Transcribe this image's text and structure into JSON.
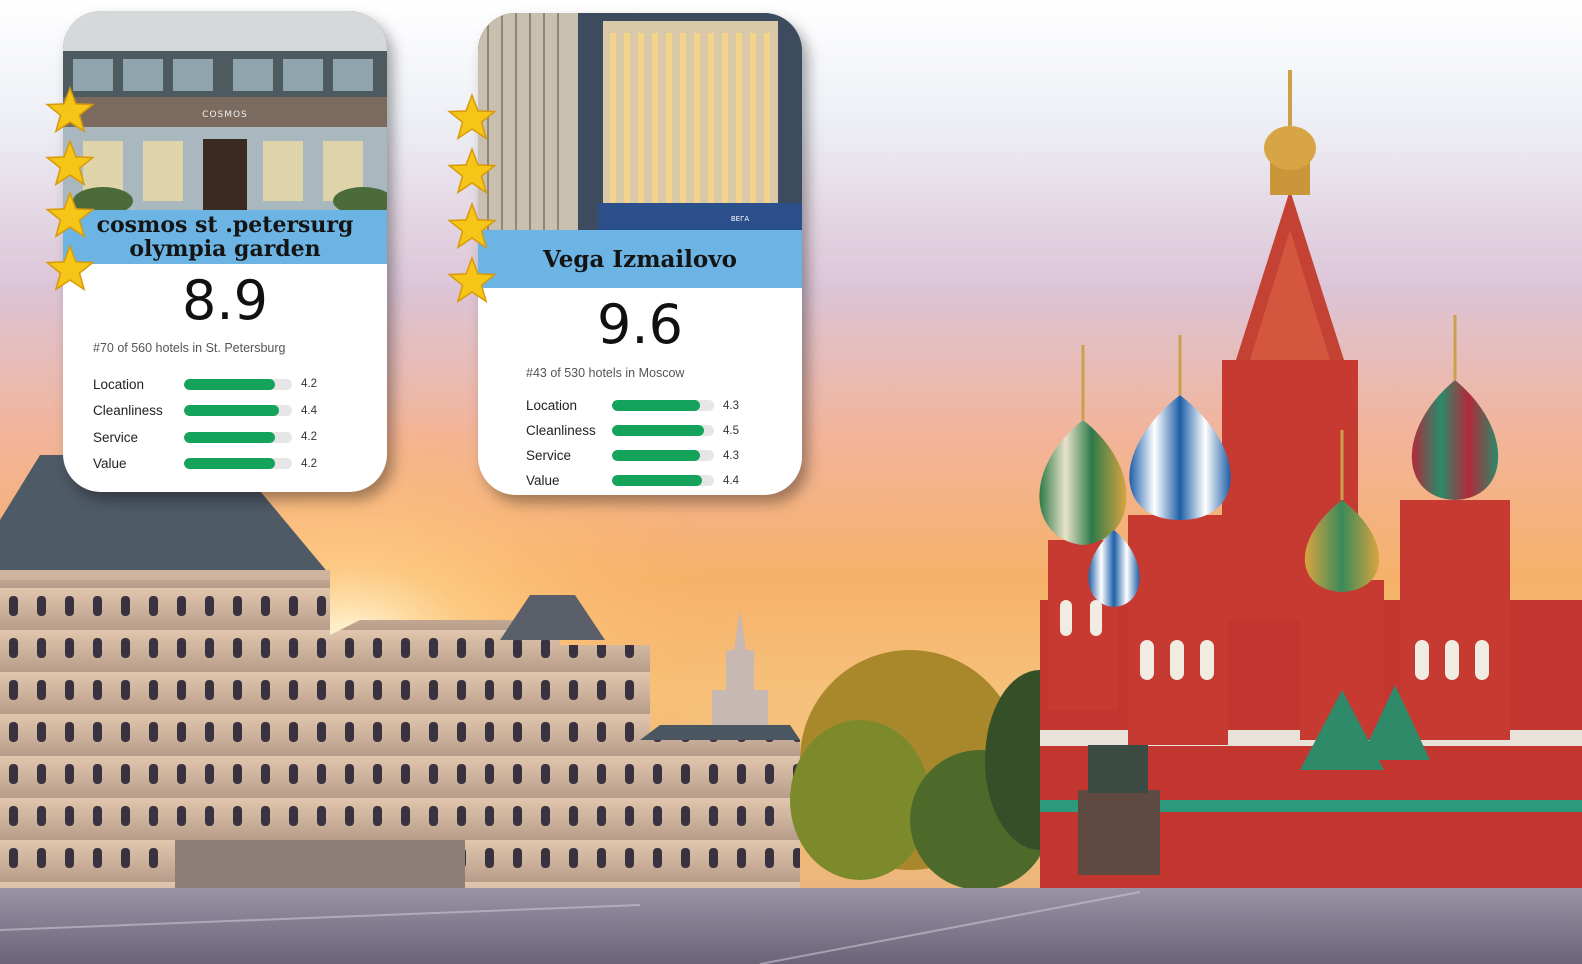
{
  "hotels": [
    {
      "name_line1": "cosmos st .petersurg",
      "name_line2": "olympia garden",
      "score": "8.9",
      "rank": "#70 of 560 hotels in St. Petersburg",
      "star_count": 4,
      "ratings": [
        {
          "label": "Location",
          "value": "4.2",
          "fraction": 0.84
        },
        {
          "label": "Cleanliness",
          "value": "4.4",
          "fraction": 0.88
        },
        {
          "label": "Service",
          "value": "4.2",
          "fraction": 0.84
        },
        {
          "label": "Value",
          "value": "4.2",
          "fraction": 0.84
        }
      ],
      "photo_sign": "COSMOS"
    },
    {
      "name": "Vega Izmailovo",
      "score": "9.6",
      "rank": "#43 of 530 hotels in Moscow",
      "star_count": 4,
      "ratings": [
        {
          "label": "Location",
          "value": "4.3",
          "fraction": 0.86
        },
        {
          "label": "Cleanliness",
          "value": "4.5",
          "fraction": 0.9
        },
        {
          "label": "Service",
          "value": "4.3",
          "fraction": 0.86
        },
        {
          "label": "Value",
          "value": "4.4",
          "fraction": 0.88
        }
      ],
      "photo_sign": "ВЕГА"
    }
  ],
  "colors": {
    "band": "#6cb4e4",
    "bar_fill": "#15a35c",
    "bar_track": "#e6e6e6",
    "star": "#f5c518"
  }
}
